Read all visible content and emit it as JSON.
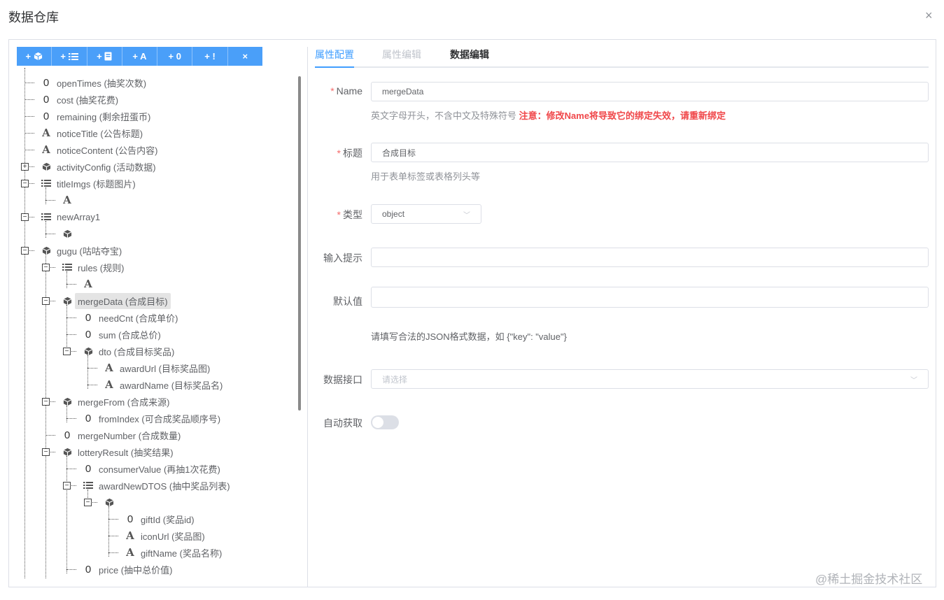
{
  "dialog": {
    "title": "数据仓库",
    "close": "×"
  },
  "toolbar": [
    {
      "label": "+",
      "icon": "object-icon"
    },
    {
      "label": "+",
      "icon": "list-icon"
    },
    {
      "label": "+",
      "icon": "document-icon"
    },
    {
      "label": "+ A",
      "icon": "text-icon"
    },
    {
      "label": "+ 0",
      "icon": "number-icon"
    },
    {
      "label": "+ !",
      "icon": "boolean-icon"
    },
    {
      "label": "×",
      "icon": "delete-icon"
    }
  ],
  "tree": [
    {
      "d": 0,
      "type": "number",
      "label": "openTimes (抽奖次数)"
    },
    {
      "d": 0,
      "type": "number",
      "label": "cost (抽奖花费)"
    },
    {
      "d": 0,
      "type": "number",
      "label": "remaining (剩余扭蛋币)"
    },
    {
      "d": 0,
      "type": "text",
      "label": "noticeTitle (公告标题)"
    },
    {
      "d": 0,
      "type": "text",
      "label": "noticeContent (公告内容)"
    },
    {
      "d": 0,
      "type": "object",
      "label": "activityConfig (活动数据)",
      "toggle": "+"
    },
    {
      "d": 0,
      "type": "list",
      "label": "titleImgs (标题图片)",
      "toggle": "-"
    },
    {
      "d": 1,
      "type": "text",
      "label": ""
    },
    {
      "d": 0,
      "type": "list",
      "label": "newArray1",
      "toggle": "-"
    },
    {
      "d": 1,
      "type": "object",
      "label": ""
    },
    {
      "d": 0,
      "type": "object",
      "label": "gugu (咕咕夺宝)",
      "toggle": "-"
    },
    {
      "d": 1,
      "type": "list",
      "label": "rules (规则)",
      "toggle": "-"
    },
    {
      "d": 2,
      "type": "text",
      "label": ""
    },
    {
      "d": 1,
      "type": "object",
      "label": "mergeData (合成目标)",
      "toggle": "-",
      "selected": true
    },
    {
      "d": 2,
      "type": "number",
      "label": "needCnt (合成单价)"
    },
    {
      "d": 2,
      "type": "number",
      "label": "sum (合成总价)"
    },
    {
      "d": 2,
      "type": "object",
      "label": "dto (合成目标奖品)",
      "toggle": "-"
    },
    {
      "d": 3,
      "type": "text",
      "label": "awardUrl (目标奖品图)"
    },
    {
      "d": 3,
      "type": "text",
      "label": "awardName (目标奖品名)"
    },
    {
      "d": 1,
      "type": "object",
      "label": "mergeFrom (合成来源)",
      "toggle": "-"
    },
    {
      "d": 2,
      "type": "number",
      "label": "fromIndex (可合成奖品顺序号)"
    },
    {
      "d": 1,
      "type": "number",
      "label": "mergeNumber (合成数量)"
    },
    {
      "d": 1,
      "type": "object",
      "label": "lotteryResult (抽奖结果)",
      "toggle": "-"
    },
    {
      "d": 2,
      "type": "number",
      "label": "consumerValue (再抽1次花费)"
    },
    {
      "d": 2,
      "type": "list",
      "label": "awardNewDTOS (抽中奖品列表)",
      "toggle": "-"
    },
    {
      "d": 3,
      "type": "object",
      "label": "",
      "toggle": "-"
    },
    {
      "d": 4,
      "type": "number",
      "label": "giftId (奖品id)"
    },
    {
      "d": 4,
      "type": "text",
      "label": "iconUrl (奖品图)"
    },
    {
      "d": 4,
      "type": "text",
      "label": "giftName (奖品名称)"
    },
    {
      "d": 2,
      "type": "number",
      "label": "price (抽中总价值)"
    }
  ],
  "tabs": [
    "属性配置",
    "属性编辑",
    "数据编辑"
  ],
  "form": {
    "name_label": "Name",
    "name_value": "mergeData",
    "name_hint": "英文字母开头，不含中文及特殊符号",
    "name_warn": "注意：修改Name将导致它的绑定失效，请重新绑定",
    "title_label": "标题",
    "title_value": "合成目标",
    "title_hint": "用于表单标签或表格列头等",
    "type_label": "类型",
    "type_value": "object",
    "placeholder_label": "输入提示",
    "default_label": "默认值",
    "default_hint": "请填写合法的JSON格式数据，如 {\"key\": \"value\"}",
    "api_label": "数据接口",
    "api_placeholder": "请选择",
    "auto_label": "自动获取",
    "auto_on": false
  },
  "watermark": "@稀土掘金技术社区",
  "colors": {
    "accent": "#409eff",
    "warn": "#f0474a",
    "toolbar": "#4a9ff9"
  }
}
